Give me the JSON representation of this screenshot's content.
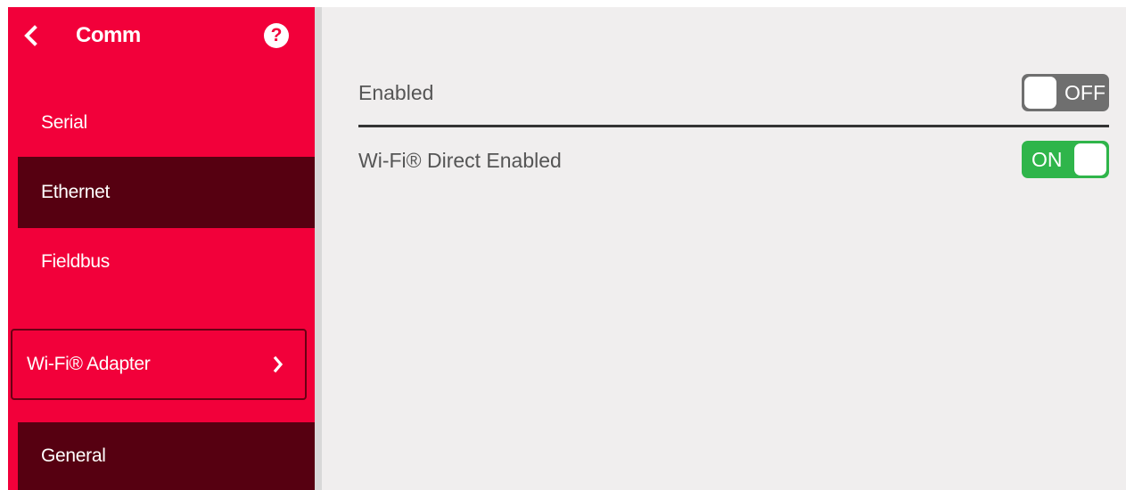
{
  "header": {
    "title": "Comm",
    "back_icon": "chevron-left-icon",
    "help_icon": "help-icon",
    "help_glyph": "?"
  },
  "sidebar": {
    "items": [
      {
        "label": "Serial",
        "active": false
      },
      {
        "label": "Ethernet",
        "active": true
      },
      {
        "label": "Fieldbus",
        "active": false
      }
    ],
    "adapter": {
      "label": "Wi-Fi® Adapter",
      "icon": "chevron-right-icon"
    },
    "sub_items": [
      {
        "label": "General",
        "active": true
      }
    ]
  },
  "settings": [
    {
      "label": "Enabled",
      "state_text": "OFF",
      "on": false
    },
    {
      "label": "Wi-Fi® Direct Enabled",
      "state_text": "ON",
      "on": true
    }
  ],
  "colors": {
    "sidebar_bg": "#f2003a",
    "active_item_bg": "#560011",
    "content_bg": "#f0eeee",
    "toggle_off": "#6f6f6f",
    "toggle_on": "#2fb54a"
  }
}
